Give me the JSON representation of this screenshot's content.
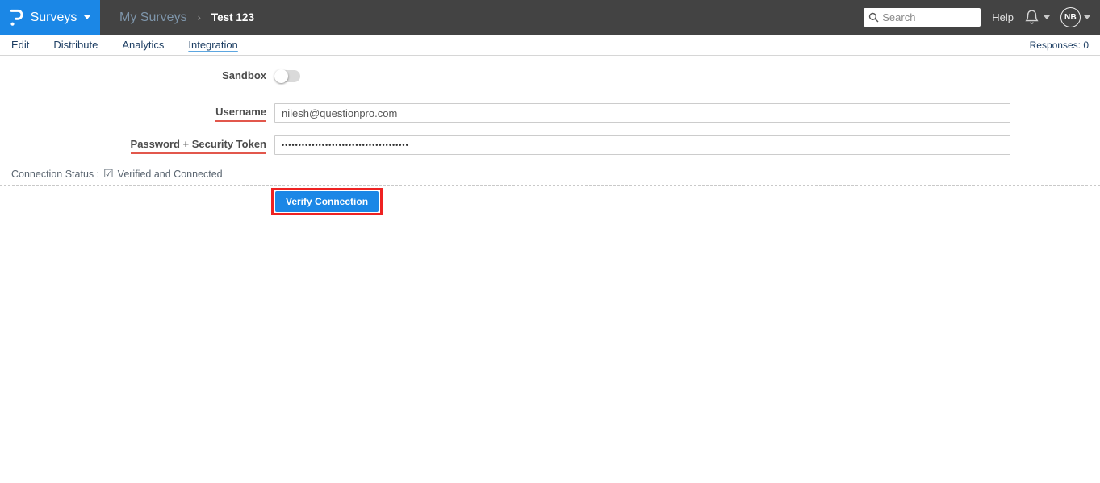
{
  "topbar": {
    "brand": {
      "label": "Surveys",
      "logo_icon": "questionpro-logo"
    },
    "breadcrumb": {
      "parent": "My Surveys",
      "separator": "›",
      "current": "Test 123"
    },
    "search": {
      "placeholder": "Search",
      "icon": "magnifier"
    },
    "help_label": "Help",
    "bell_icon": "notification-bell",
    "avatar_initials": "NB"
  },
  "tabs": {
    "items": [
      {
        "label": "Edit",
        "active": false
      },
      {
        "label": "Distribute",
        "active": false
      },
      {
        "label": "Analytics",
        "active": false
      },
      {
        "label": "Integration",
        "active": true
      }
    ],
    "responses_label": "Responses: 0"
  },
  "form": {
    "sandbox": {
      "label": "Sandbox",
      "enabled": false
    },
    "username": {
      "label": "Username",
      "value": "nilesh@questionpro.com"
    },
    "password": {
      "label": "Password + Security Token",
      "value": "••••••••••••••••••••••••••••••••••••••"
    },
    "connection_status": {
      "label": "Connection Status :",
      "checkbox_glyph": "☑",
      "value": "Verified and Connected"
    },
    "verify_button_label": "Verify Connection"
  },
  "colors": {
    "brand_blue": "#1b87e6",
    "topbar_bg": "#434343",
    "tab_text": "#1d3e63",
    "label_underline_red": "#e2574c",
    "annotation_red": "#ee2222",
    "button_blue": "#1b87e6"
  }
}
